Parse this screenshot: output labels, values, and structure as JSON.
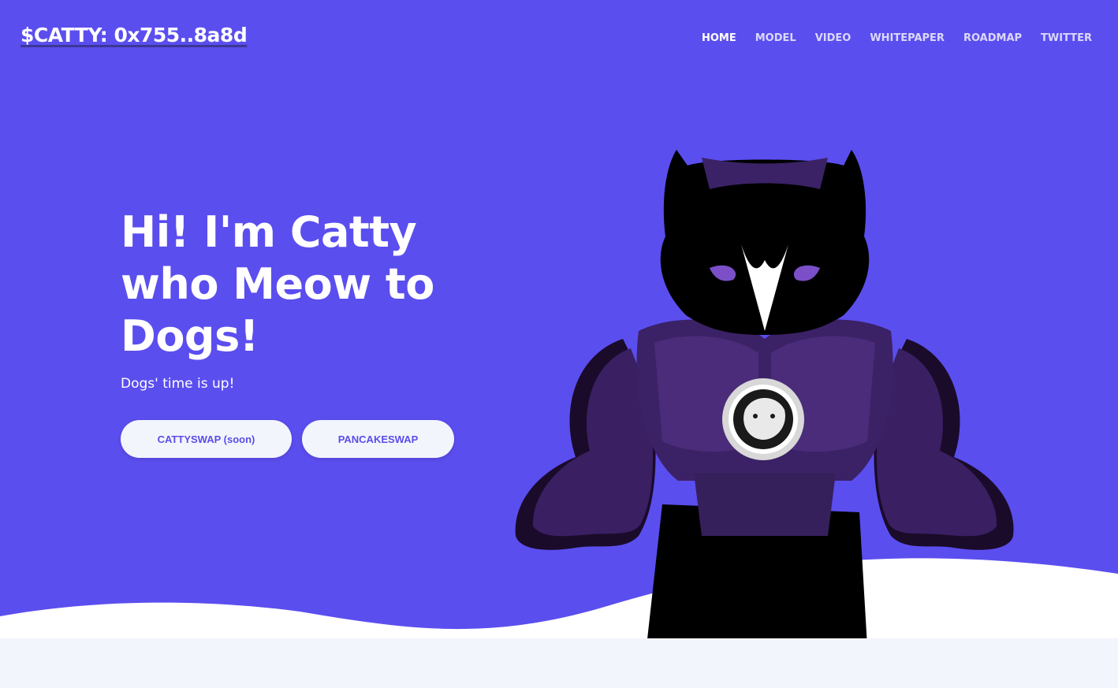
{
  "colors": {
    "hero_bg": "#5b4eef",
    "accent": "#5b4de8",
    "light_band": "#f3f5fd"
  },
  "header": {
    "brand": "$CATTY: 0x755..8a8d",
    "nav": [
      {
        "label": "HOME",
        "active": true
      },
      {
        "label": "MODEL"
      },
      {
        "label": "VIDEO"
      },
      {
        "label": "WHITEPAPER"
      },
      {
        "label": "ROADMAP"
      },
      {
        "label": "TWITTER"
      }
    ]
  },
  "hero": {
    "headline_line1": "Hi! I'm Catty",
    "headline_line2": "who Meow to",
    "headline_line3": "Dogs!",
    "subline": "Dogs' time is up!",
    "buttons": {
      "cattyswap": "CATTYSWAP (soon)",
      "pancakeswap": "PANCAKESWAP"
    }
  },
  "mascot": {
    "icon": "muscular-cat-mascot",
    "badge_icon": "cat-head-emblem-icon"
  }
}
